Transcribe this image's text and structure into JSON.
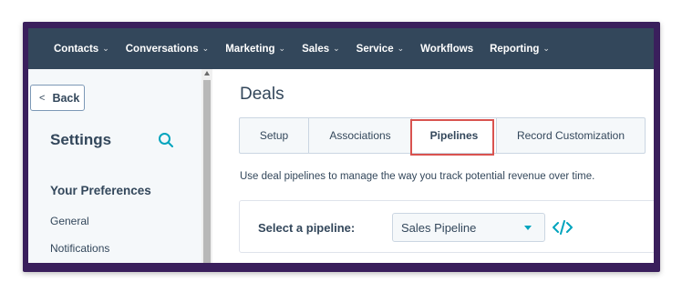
{
  "topnav": {
    "items": [
      {
        "label": "Contacts",
        "dropdown": true
      },
      {
        "label": "Conversations",
        "dropdown": true
      },
      {
        "label": "Marketing",
        "dropdown": true
      },
      {
        "label": "Sales",
        "dropdown": true
      },
      {
        "label": "Service",
        "dropdown": true
      },
      {
        "label": "Workflows",
        "dropdown": false
      },
      {
        "label": "Reporting",
        "dropdown": true
      }
    ]
  },
  "sidebar": {
    "back_label": "Back",
    "title": "Settings",
    "section_heading": "Your Preferences",
    "links": [
      "General",
      "Notifications"
    ]
  },
  "main": {
    "title": "Deals",
    "tabs": [
      {
        "label": "Setup",
        "active": false
      },
      {
        "label": "Associations",
        "active": false
      },
      {
        "label": "Pipelines",
        "active": true
      },
      {
        "label": "Record Customization",
        "active": false
      }
    ],
    "description": "Use deal pipelines to manage the way you track potential revenue over time.",
    "pipeline_label": "Select a pipeline:",
    "pipeline_value": "Sales Pipeline"
  },
  "colors": {
    "nav_bg": "#33475b",
    "accent": "#00a4bd",
    "highlight": "#d9534f",
    "frame": "#3a1f5c"
  },
  "icons": [
    "chevron-down-icon",
    "chevron-left-icon",
    "search-icon",
    "caret-down-icon",
    "code-icon"
  ]
}
